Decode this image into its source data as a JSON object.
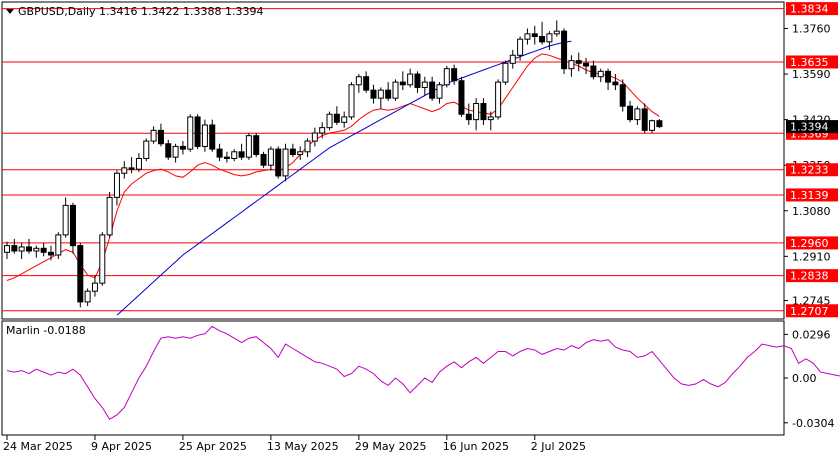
{
  "header": {
    "symbol_line": "GBPUSD,Daily  1.3416 1.3422 1.3388 1.3394"
  },
  "indicator": {
    "label": "Marlin -0.0188",
    "ticks": [
      {
        "value": 0.0296,
        "label": "0.0296"
      },
      {
        "value": 0.0,
        "label": "0.00"
      },
      {
        "value": -0.0304,
        "label": "-0.0304"
      }
    ],
    "values": [
      0.005,
      0.004,
      0.005,
      0.003,
      0.006,
      0.004,
      0.002,
      0.004,
      0.003,
      0.006,
      0.002,
      -0.006,
      -0.014,
      -0.02,
      -0.028,
      -0.025,
      -0.02,
      -0.01,
      0.0,
      0.008,
      0.018,
      0.027,
      0.028,
      0.027,
      0.028,
      0.027,
      0.029,
      0.03,
      0.035,
      0.032,
      0.03,
      0.027,
      0.024,
      0.027,
      0.028,
      0.024,
      0.02,
      0.014,
      0.023,
      0.02,
      0.017,
      0.014,
      0.011,
      0.01,
      0.008,
      0.006,
      0.001,
      0.003,
      0.008,
      0.006,
      0.003,
      -0.002,
      -0.005,
      0.0,
      -0.004,
      -0.01,
      -0.005,
      0.0,
      -0.003,
      0.004,
      0.008,
      0.011,
      0.007,
      0.011,
      0.014,
      0.01,
      0.014,
      0.018,
      0.018,
      0.015,
      0.018,
      0.02,
      0.019,
      0.016,
      0.018,
      0.02,
      0.019,
      0.022,
      0.02,
      0.024,
      0.026,
      0.025,
      0.026,
      0.021,
      0.019,
      0.018,
      0.014,
      0.015,
      0.018,
      0.012,
      0.006,
      0.0,
      -0.004,
      -0.005,
      -0.004,
      -0.001,
      -0.004,
      -0.006,
      -0.003,
      0.003,
      0.008,
      0.014,
      0.018,
      0.023,
      0.022,
      0.021,
      0.022,
      0.02,
      0.01,
      0.013,
      0.01,
      0.004,
      0.003,
      0.002,
      0.001,
      -0.002,
      -0.008,
      -0.014,
      -0.016,
      -0.013,
      -0.017,
      -0.015
    ],
    "color": "#c000c0"
  },
  "chart_data": {
    "type": "candlestick",
    "title": "GBPUSD,Daily  1.3416 1.3422 1.3388 1.3394",
    "y_ticks": [
      {
        "value": 1.376,
        "label": "1.3760"
      },
      {
        "value": 1.359,
        "label": "1.3590"
      },
      {
        "value": 1.342,
        "label": "1.3420"
      },
      {
        "value": 1.325,
        "label": "1.3250"
      },
      {
        "value": 1.308,
        "label": "1.3080"
      },
      {
        "value": 1.291,
        "label": "1.2910"
      },
      {
        "value": 1.2745,
        "label": "1.2745"
      }
    ],
    "ylim": [
      1.268,
      1.3855
    ],
    "x_ticks": [
      {
        "index": 0,
        "label": "24 Mar 2025"
      },
      {
        "index": 12,
        "label": "9 Apr 2025"
      },
      {
        "index": 24,
        "label": "25 Apr 2025"
      },
      {
        "index": 36,
        "label": "13 May 2025"
      },
      {
        "index": 48,
        "label": "29 May 2025"
      },
      {
        "index": 60,
        "label": "16 Jun 2025"
      },
      {
        "index": 72,
        "label": "2 Jul 2025"
      }
    ],
    "levels": [
      {
        "value": 1.3834,
        "label": "1.3834"
      },
      {
        "value": 1.3635,
        "label": "1.3635"
      },
      {
        "value": 1.3369,
        "label": "1.3369"
      },
      {
        "value": 1.3233,
        "label": "1.3233"
      },
      {
        "value": 1.3139,
        "label": "1.3139"
      },
      {
        "value": 1.296,
        "label": "1.2960"
      },
      {
        "value": 1.2838,
        "label": "1.2838"
      },
      {
        "value": 1.2707,
        "label": "1.2707"
      }
    ],
    "current_price": {
      "value": 1.3394,
      "label": "1.3394"
    },
    "candles": [
      [
        1.2925,
        1.2965,
        1.29,
        1.295
      ],
      [
        1.295,
        1.2975,
        1.292,
        1.293
      ],
      [
        1.293,
        1.296,
        1.29,
        1.2945
      ],
      [
        1.2945,
        1.2975,
        1.292,
        1.293
      ],
      [
        1.293,
        1.295,
        1.2905,
        1.294
      ],
      [
        1.294,
        1.296,
        1.291,
        1.2925
      ],
      [
        1.2925,
        1.295,
        1.2895,
        1.2915
      ],
      [
        1.2915,
        1.3,
        1.29,
        1.299
      ],
      [
        1.299,
        1.313,
        1.298,
        1.31
      ],
      [
        1.31,
        1.311,
        1.292,
        1.295
      ],
      [
        1.295,
        1.296,
        1.272,
        1.274
      ],
      [
        1.274,
        1.279,
        1.2725,
        1.278
      ],
      [
        1.278,
        1.284,
        1.276,
        1.281
      ],
      [
        1.281,
        1.3,
        1.28,
        1.299
      ],
      [
        1.299,
        1.315,
        1.298,
        1.313
      ],
      [
        1.313,
        1.323,
        1.31,
        1.322
      ],
      [
        1.322,
        1.3265,
        1.32,
        1.324
      ],
      [
        1.324,
        1.328,
        1.322,
        1.3235
      ],
      [
        1.3235,
        1.3295,
        1.3225,
        1.3275
      ],
      [
        1.3275,
        1.335,
        1.3265,
        1.334
      ],
      [
        1.334,
        1.3395,
        1.333,
        1.338
      ],
      [
        1.338,
        1.3405,
        1.332,
        1.333
      ],
      [
        1.333,
        1.3345,
        1.327,
        1.328
      ],
      [
        1.328,
        1.333,
        1.326,
        1.332
      ],
      [
        1.332,
        1.334,
        1.329,
        1.331
      ],
      [
        1.331,
        1.344,
        1.33,
        1.343
      ],
      [
        1.343,
        1.344,
        1.331,
        1.332
      ],
      [
        1.332,
        1.342,
        1.33,
        1.34
      ],
      [
        1.34,
        1.342,
        1.33,
        1.331
      ],
      [
        1.331,
        1.333,
        1.3265,
        1.328
      ],
      [
        1.328,
        1.33,
        1.326,
        1.3275
      ],
      [
        1.3275,
        1.331,
        1.3265,
        1.33
      ],
      [
        1.33,
        1.333,
        1.327,
        1.328
      ],
      [
        1.328,
        1.337,
        1.327,
        1.336
      ],
      [
        1.336,
        1.337,
        1.328,
        1.329
      ],
      [
        1.329,
        1.33,
        1.324,
        1.325
      ],
      [
        1.325,
        1.332,
        1.323,
        1.331
      ],
      [
        1.331,
        1.332,
        1.32,
        1.321
      ],
      [
        1.321,
        1.333,
        1.319,
        1.331
      ],
      [
        1.331,
        1.333,
        1.328,
        1.329
      ],
      [
        1.329,
        1.332,
        1.327,
        1.33
      ],
      [
        1.33,
        1.335,
        1.328,
        1.334
      ],
      [
        1.334,
        1.339,
        1.332,
        1.337
      ],
      [
        1.337,
        1.341,
        1.335,
        1.339
      ],
      [
        1.339,
        1.345,
        1.338,
        1.344
      ],
      [
        1.344,
        1.347,
        1.34,
        1.341
      ],
      [
        1.341,
        1.345,
        1.339,
        1.343
      ],
      [
        1.343,
        1.356,
        1.342,
        1.355
      ],
      [
        1.355,
        1.359,
        1.352,
        1.358
      ],
      [
        1.358,
        1.36,
        1.352,
        1.353
      ],
      [
        1.353,
        1.355,
        1.348,
        1.35
      ],
      [
        1.35,
        1.354,
        1.346,
        1.353
      ],
      [
        1.353,
        1.356,
        1.349,
        1.35
      ],
      [
        1.35,
        1.357,
        1.349,
        1.356
      ],
      [
        1.356,
        1.36,
        1.353,
        1.355
      ],
      [
        1.355,
        1.361,
        1.354,
        1.359
      ],
      [
        1.359,
        1.36,
        1.352,
        1.354
      ],
      [
        1.354,
        1.358,
        1.351,
        1.356
      ],
      [
        1.356,
        1.358,
        1.349,
        1.35
      ],
      [
        1.35,
        1.356,
        1.348,
        1.355
      ],
      [
        1.355,
        1.362,
        1.354,
        1.361
      ],
      [
        1.361,
        1.3625,
        1.355,
        1.3565
      ],
      [
        1.3565,
        1.358,
        1.343,
        1.344
      ],
      [
        1.344,
        1.348,
        1.34,
        1.342
      ],
      [
        1.342,
        1.35,
        1.338,
        1.348
      ],
      [
        1.348,
        1.35,
        1.34,
        1.342
      ],
      [
        1.342,
        1.345,
        1.338,
        1.343
      ],
      [
        1.343,
        1.357,
        1.342,
        1.356
      ],
      [
        1.356,
        1.364,
        1.355,
        1.363
      ],
      [
        1.363,
        1.368,
        1.361,
        1.366
      ],
      [
        1.366,
        1.373,
        1.364,
        1.372
      ],
      [
        1.372,
        1.376,
        1.37,
        1.374
      ],
      [
        1.374,
        1.377,
        1.37,
        1.373
      ],
      [
        1.373,
        1.3785,
        1.37,
        1.371
      ],
      [
        1.371,
        1.375,
        1.368,
        1.374
      ],
      [
        1.374,
        1.379,
        1.373,
        1.375
      ],
      [
        1.375,
        1.376,
        1.359,
        1.361
      ],
      [
        1.361,
        1.366,
        1.358,
        1.364
      ],
      [
        1.364,
        1.367,
        1.36,
        1.363
      ],
      [
        1.363,
        1.365,
        1.359,
        1.362
      ],
      [
        1.362,
        1.364,
        1.357,
        1.358
      ],
      [
        1.358,
        1.361,
        1.356,
        1.36
      ],
      [
        1.36,
        1.361,
        1.353,
        1.356
      ],
      [
        1.356,
        1.359,
        1.353,
        1.355
      ],
      [
        1.355,
        1.357,
        1.345,
        1.347
      ],
      [
        1.347,
        1.349,
        1.341,
        1.342
      ],
      [
        1.342,
        1.347,
        1.34,
        1.346
      ],
      [
        1.346,
        1.348,
        1.337,
        1.338
      ],
      [
        1.338,
        1.342,
        1.337,
        1.3416
      ],
      [
        1.3416,
        1.3422,
        1.3388,
        1.3394
      ]
    ],
    "ma_fast": [
      1.282,
      1.283,
      1.2845,
      1.286,
      1.2875,
      1.289,
      1.2905,
      1.292,
      1.2935,
      1.2925,
      1.288,
      1.284,
      1.283,
      1.289,
      1.298,
      1.308,
      1.315,
      1.318,
      1.32,
      1.322,
      1.323,
      1.3235,
      1.3225,
      1.321,
      1.3205,
      1.3225,
      1.325,
      1.326,
      1.325,
      1.3235,
      1.3225,
      1.3215,
      1.321,
      1.3215,
      1.3225,
      1.323,
      1.3235,
      1.323,
      1.324,
      1.326,
      1.329,
      1.332,
      1.3345,
      1.336,
      1.337,
      1.3375,
      1.338,
      1.3395,
      1.342,
      1.344,
      1.3455,
      1.346,
      1.3455,
      1.346,
      1.347,
      1.348,
      1.347,
      1.346,
      1.345,
      1.346,
      1.348,
      1.3485,
      1.347,
      1.3455,
      1.345,
      1.3445,
      1.344,
      1.346,
      1.35,
      1.354,
      1.358,
      1.362,
      1.365,
      1.3665,
      1.366,
      1.365,
      1.364,
      1.363,
      1.362,
      1.3605,
      1.3595,
      1.359,
      1.3585,
      1.3575,
      1.356,
      1.353,
      1.35,
      1.3475,
      1.345,
      1.3432
    ],
    "ma_slow": [
      1.25,
      1.251,
      1.252,
      1.253,
      1.254,
      1.255,
      1.256,
      1.257,
      1.258,
      1.259,
      1.26,
      1.261,
      1.262,
      1.264,
      1.2665,
      1.269,
      1.2715,
      1.274,
      1.2765,
      1.279,
      1.2815,
      1.284,
      1.2865,
      1.289,
      1.2915,
      1.2935,
      1.2955,
      1.2975,
      1.2995,
      1.3015,
      1.3035,
      1.3055,
      1.3075,
      1.3095,
      1.3115,
      1.3135,
      1.3155,
      1.3175,
      1.3195,
      1.3215,
      1.3235,
      1.3255,
      1.3275,
      1.3295,
      1.3315,
      1.333,
      1.3345,
      1.336,
      1.3375,
      1.339,
      1.3405,
      1.342,
      1.3435,
      1.345,
      1.3465,
      1.348,
      1.3495,
      1.351,
      1.3525,
      1.354,
      1.3555,
      1.3565,
      1.3575,
      1.3585,
      1.3595,
      1.3605,
      1.3615,
      1.3625,
      1.3635,
      1.3645,
      1.3655,
      1.3665,
      1.3675,
      1.3685,
      1.3695,
      1.3702,
      1.3708,
      1.3712,
      1.3716,
      1.372,
      1.3723,
      1.3725,
      1.3727,
      1.3728,
      1.3729,
      1.373,
      1.373,
      1.373,
      1.373,
      1.373
    ],
    "ma_slow_start_index": 14,
    "ma_slow_end_index": 77,
    "colors": {
      "level": "#ff0000",
      "ma_fast": "#ff0000",
      "ma_slow": "#0000cd",
      "candle": "#000000",
      "bull_fill": "#ffffff",
      "bear_fill": "#000000",
      "price_tag_bg": "#000000",
      "level_tag_bg": "#ff0000"
    },
    "grid": false
  }
}
